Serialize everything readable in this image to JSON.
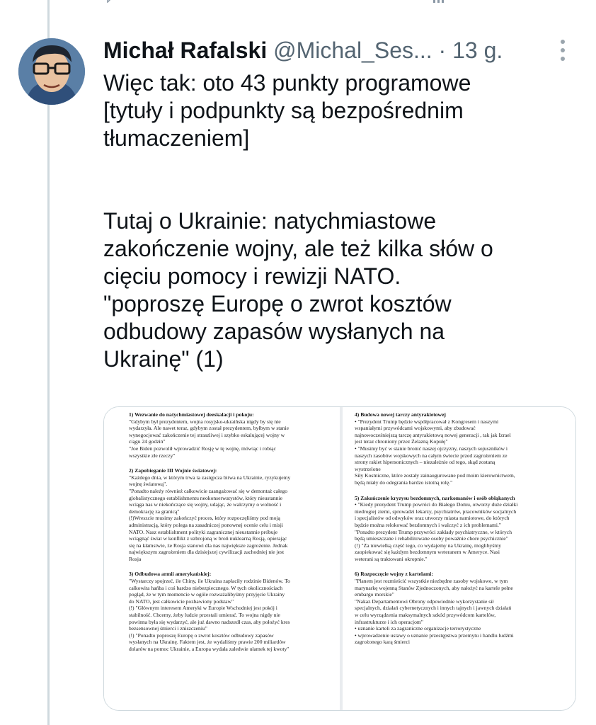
{
  "author": {
    "name": "Michał Rafalski",
    "handle": "@Michal_Ses...",
    "separator": "·",
    "time": "13 g."
  },
  "tweet": {
    "lines_block1": [
      "Więc tak: oto 43 punkty programowe",
      "[tytuły i podpunkty są bezpośrednim",
      "tłumaczeniem]"
    ],
    "lines_block2": [
      "Tutaj o Ukrainie: natychmiastowe",
      "zakończenie wojny, ale też kilka słów o",
      "cięciu pomocy i rewizji NATO.",
      "\"poproszę Europę o zwrot kosztów",
      "odbudowy zapasów wysłanych na",
      "Ukrainę\" (1)"
    ]
  },
  "icons": {
    "top_strip": [
      "reply-icon",
      "retweet-icon",
      "like-icon",
      "views-icon",
      "share-icon"
    ],
    "more": "more-icon"
  },
  "document": {
    "left_sections": [
      {
        "heading": "1) Wezwanie do natychmiastowej deeskalacji i pokoju:",
        "lines": [
          "\"Gdybym był prezydentem, wojna rosyjsko-ukraińska nigdy by się nie",
          "wydarzyła. Ale nawet teraz, gdybym został prezydentem, byłbym w stanie",
          "wynegocjować zakończenie tej straszliwej i szybko eskalującej wojny w",
          "ciągu 24 godzin\"",
          "\"Joe Biden pozwolił wprowadzić Rosję w tę wojnę, mówiąc i robiąc",
          "wszystkie złe rzeczy\""
        ]
      },
      {
        "heading": "2) Zapobieganie III Wojnie światowej:",
        "lines": [
          "\"Każdego dnia, w którym trwa ta zastępcza bitwa na Ukrainie, ryzykujemy",
          "wojnę światową\".",
          "\"Ponadto należy również całkowicie zaangażować się w demontaż całego",
          "globalistycznego establishmentu neokonserwatystów, który nieustannie",
          "wciąga nas w niekończące się wojny, udając, że walczymy o wolność i",
          "demokrację za granicą\"",
          "(!)Wreszcie musimy zakończyć proces, który rozpoczęliśmy pod moją",
          "administracją, który polega na zasadniczej ponownej ocenie celu i misji",
          "NATO. Nasz establishment polityki zagranicznej nieustannie próbuje",
          "wciągnąć świat w konflikt z uzbrojoną w broń nuklearną Rosją, opierając",
          "się na kłamstwie, że Rosja stanowi dla nas największe zagrożenie. Jednak",
          "największym zagrożeniem dla dzisiejszej cywilizacji zachodniej nie jest",
          "Rosja"
        ]
      },
      {
        "heading": "3) Odbudowa armii amerykańskiej:",
        "lines": [
          "\"Wystarczy spojrzeć, ile Chiny, ile Ukraina zapłaciły rodzinie Bidenów. To",
          "całkowita hańba i coś bardzo niebezpiecznego. W tych okolicznościach",
          "pogląd, że w tym momencie w ogóle rozważalibyśmy przyjęcie Ukrainy",
          "do NATO, jest całkowicie pozbawiony podstaw\"",
          "(!) \"Głównym interesem Ameryki w Europie Wschodniej jest pokój i",
          "stabilność. Chcemy, żeby ludzie przestali umierać. To wojna nigdy nie",
          "powinna była się wydarzyć, ale już dawno nadszedł czas, aby położyć kres",
          "bezsensownej śmierci i zniszczeniu\"",
          "(!) \"Ponadto poproszę Europę o zwrot kosztów odbudowy zapasów",
          "wysłanych na Ukrainę. Faktem jest, że wydaliśmy prawie 200 miliardów",
          "dolarów na pomoc Ukrainie, a Europa wydała zaledwie ułamek tej kwoty\""
        ]
      }
    ],
    "right_sections": [
      {
        "heading": "4) Budowa nowej tarczy antyrakietowej",
        "lines": [
          "• \"Prezydent Trump będzie współpracował z Kongresem i naszymi",
          "wspaniałymi przywódcami wojskowymi, aby zbudować",
          "najnowocześniejszą tarczę antyrakietową nowej generacji , tak jak Izrael",
          "jest teraz chroniony przez Żelazną Kopułę\"",
          "• \"Musimy być w stanie bronić naszej ojczyzny, naszych sojuszników i",
          "naszych zasobów wojskowych na całym świecie przed zagrożeniem ze",
          "strony rakiet hipersonicznych – niezależnie od tego, skąd zostaną",
          "wystrzelone",
          "Siły Kosmiczne, które zostały zainaugurowane pod moim kierownictwem,",
          "będą miały do odegrania bardzo istotną rolę.\""
        ]
      },
      {
        "heading": "5) Zakończenie kryzysu bezdomnych, narkomanów i osób obłąkanych",
        "lines": [
          "• \"Kiedy prezydent Trump powróci do Białego Domu, otworzy duże działki",
          "niedrogiej ziemi, sprowadzi lekarzy, psychiatrów, pracowników socjalnych",
          "i specjalistów od odwyków oraz utworzy miasta namiotowe, do których",
          "będzie można relokować bezdomnych i walczyć z ich problemami.\"",
          "\"Ponadto prezydent Trump przywróci zakłady psychiatryczne, w których",
          "będą umieszczane i rehabilitowane osoby poważnie chore psychicznie\"",
          "(!) \"Za niewielką część tego, co wydajemy na Ukrainę, moglibyśmy",
          "zaopiekować się każdym bezdomnym weteranem w Ameryce. Nasi",
          "weterani są traktowani okropnie.\""
        ]
      },
      {
        "heading": "6) Rozpoczęcie wojny z kartelami:",
        "lines": [
          "\"Planem jest rozmieścić wszystkie niezbędne zasoby wojskowe, w tym",
          "marynarkę wojenną Stanów Zjednoczonych, aby nałożyć na kartele pełne",
          "embargo morskie\"",
          "\"Nakaz Departamentowi Obrony odpowiednie wykorzystanie sił",
          "specjalnych, działań cybernetycznych i innych tajnych i jawnych działań",
          "w celu wyrządzenia maksymalnych szkód przywódcom kartelów,",
          "infrastrukturze i ich operacjom\"",
          "• uznanie karteli za zagraniczne organizacje terrorystyczne",
          "• wprowadzenie ustawy o uznanie przestępstwa przemytu i handlu ludźmi",
          "zagrożonego karą śmierci"
        ]
      }
    ],
    "footnote": "..."
  }
}
